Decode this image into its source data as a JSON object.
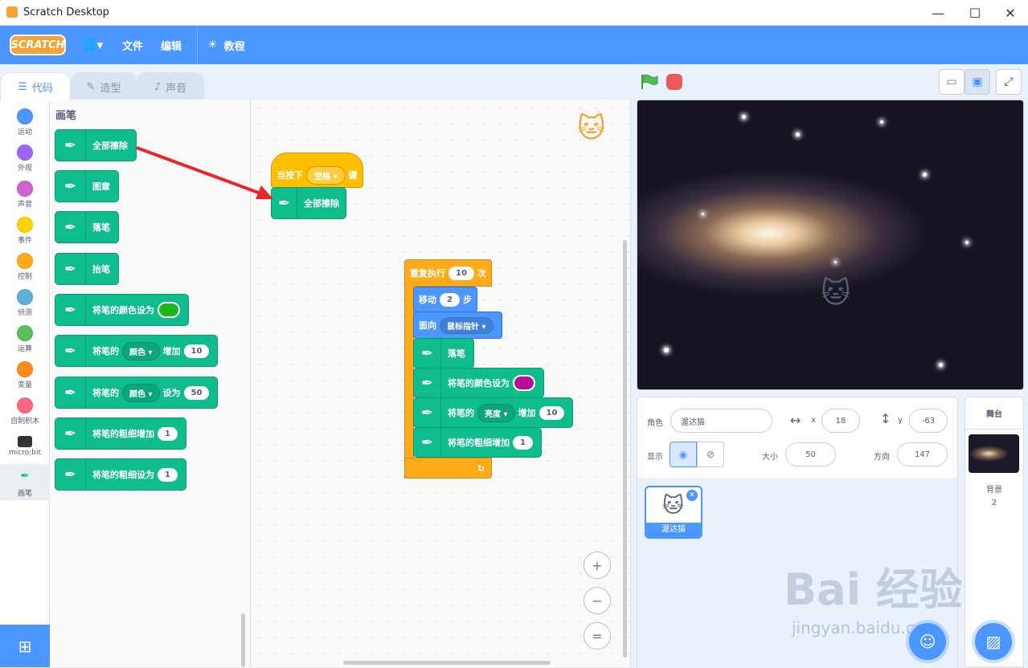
{
  "window": {
    "title": "Scratch Desktop",
    "min": "—",
    "max": "☐",
    "close": "✕"
  },
  "menu": {
    "logo": "SCRATCH",
    "globe": "🌐▾",
    "file": "文件",
    "edit": "编辑",
    "tutorials": "教程"
  },
  "tabs": [
    {
      "label": "代码",
      "icon": "code-icon"
    },
    {
      "label": "造型",
      "icon": "brush-icon"
    },
    {
      "label": "声音",
      "icon": "speaker-icon"
    }
  ],
  "categories": [
    {
      "label": "运动",
      "color": "#4c97ff"
    },
    {
      "label": "外观",
      "color": "#9966ff"
    },
    {
      "label": "声音",
      "color": "#cf63cf"
    },
    {
      "label": "事件",
      "color": "#ffd500"
    },
    {
      "label": "控制",
      "color": "#ffab19"
    },
    {
      "label": "侦测",
      "color": "#5cb1d6"
    },
    {
      "label": "运算",
      "color": "#59c059"
    },
    {
      "label": "变量",
      "color": "#ff8c1a"
    },
    {
      "label": "自制积木",
      "color": "#ff6680"
    },
    {
      "label": "micro:bit",
      "color": "#333333"
    },
    {
      "label": "画笔",
      "color": "#0fbd8c"
    }
  ],
  "palette": {
    "heading": "画笔",
    "clear": "全部擦除",
    "stamp": "图章",
    "pen_down": "落笔",
    "pen_up": "抬笔",
    "set_color": "将笔的颜色设为",
    "change_param_pre": "将笔的",
    "color_param": "颜色",
    "change_by": "增加",
    "set_to": "设为",
    "change_value": "10",
    "set_value": "50",
    "change_size": "将笔的粗细增加",
    "change_size_value": "1",
    "set_size": "将笔的粗细设为",
    "set_size_value": "1",
    "pen_color": "#1bb81b"
  },
  "script1": {
    "when_key": "当按下",
    "key": "空格",
    "key_suffix": "键",
    "clear": "全部擦除"
  },
  "script2": {
    "repeat": "重复执行",
    "repeat_count": "10",
    "repeat_suffix": "次",
    "move": "移动",
    "move_steps": "2",
    "move_suffix": "步",
    "point": "面向",
    "point_target": "鼠标指针",
    "pen_down": "落笔",
    "set_color": "将笔的颜色设为",
    "pen_color": "#b40f96",
    "change_pre": "将笔的",
    "param": "亮度",
    "change_by": "增加",
    "change_value": "10",
    "change_size": "将笔的粗细增加",
    "change_size_value": "1",
    "loop_arrow": "↻"
  },
  "zoom": {
    "in": "+",
    "out": "−",
    "reset": "="
  },
  "sprite": {
    "label_sprite": "角色",
    "name": "渥达猫",
    "x_label": "x",
    "x": "18",
    "y_label": "y",
    "y": "-63",
    "show_label": "显示",
    "size_label": "大小",
    "size": "50",
    "direction_label": "方向",
    "direction": "147"
  },
  "sprite_list": [
    {
      "name": "渥达猫"
    }
  ],
  "stage_panel": {
    "title": "舞台",
    "backdrop_label": "背景",
    "backdrop_count": "2"
  },
  "watermark": {
    "brand": "Bai 经验",
    "url": "jingyan.baidu.com"
  }
}
